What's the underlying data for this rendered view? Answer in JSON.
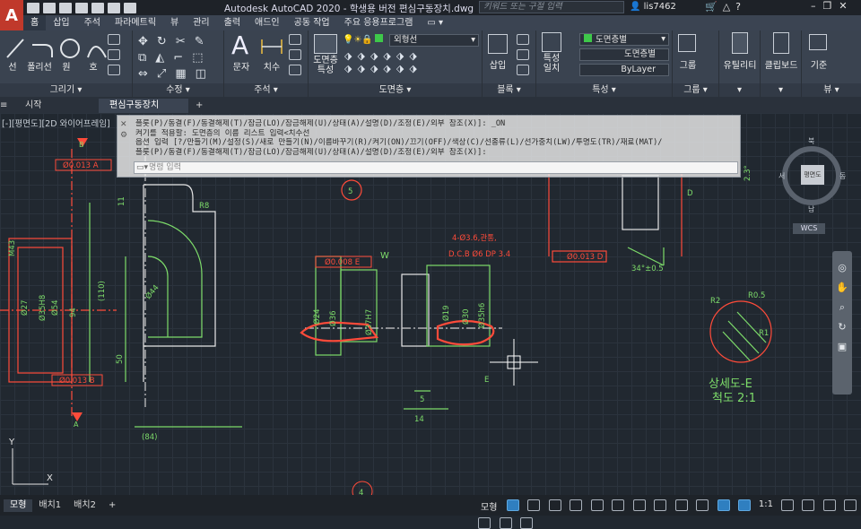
{
  "app": {
    "title": "Autodesk AutoCAD 2020 - 학생용 버전    편심구동장치.dwg",
    "search_placeholder": "키워드 또는 구절 입력",
    "user": "lis7462",
    "app_letter": "A"
  },
  "ribbon_tabs": [
    "홈",
    "삽입",
    "주석",
    "파라메트릭",
    "뷰",
    "관리",
    "출력",
    "애드인",
    "공동 작업",
    "주요 응용프로그램"
  ],
  "ribbon": {
    "draw": {
      "title": "그리기",
      "tools": [
        "선",
        "폴리선",
        "원",
        "호"
      ]
    },
    "modify": {
      "title": "수정"
    },
    "annotation": {
      "title": "주석",
      "tools": [
        "문자",
        "치수"
      ]
    },
    "layers": {
      "title": "도면층",
      "tool": "도면층 특성",
      "current_layer": "외형선"
    },
    "block": {
      "title": "블록",
      "tool": "삽입"
    },
    "properties": {
      "title": "특성",
      "tool": "특성 일치",
      "color": "도면층별",
      "linetype": "도면층별",
      "lineweight": "ByLayer"
    },
    "groups": {
      "title": "그룹",
      "tool": "그룹"
    },
    "utilities": {
      "tool": "유틸리티"
    },
    "clipboard": {
      "tool": "클립보드"
    },
    "view": {
      "title": "뷰",
      "tool": "기준"
    }
  },
  "file_tabs": [
    "시작",
    "편심구동장치*"
  ],
  "viewport_label": "[-][평면도][2D 와이어프레임]",
  "command": {
    "lines": [
      "플롯(P)/동결(F)/동결해제(T)/잠금(LO)/잠금해제(U)/상태(A)/설명(D)/조정(E)/외부 참조(X)]: _ON",
      "켜기를 적용할:  도면층의 이름 리스트 입력<치수선",
      "옵션 입력 [?/만들기(M)/설정(S)/새로 만들기(N)/이름바꾸기(R)/켜기(ON)/끄기(OFF)/색상(C)/선종류(L)/선가중치(LW)/투명도(TR)/재료(MAT)/",
      "플롯(P)/동결(F)/동결해제(T)/잠금(LO)/잠금해제(U)/상태(A)/설명(D)/조정(E)/외부 참조(X)]:"
    ],
    "input_placeholder": "명령 입력"
  },
  "viewcube": {
    "face": "평면도",
    "north": "북",
    "east": "동",
    "west": "서",
    "south": "남",
    "wcs": "WCS"
  },
  "drawing": {
    "dims_left": [
      "Ø0.013 A",
      "Ø0.013 B",
      "(84)",
      "(110)",
      "94",
      "50",
      "11",
      "R8",
      "Ø44",
      "Ø54",
      "Ø35H8",
      "Ø27",
      "M43"
    ],
    "labels": [
      "B",
      "A",
      "5",
      "W",
      "E",
      "D",
      "4"
    ],
    "center": [
      "4-Ø3.6,관통,",
      "D.C.B  Ø6  DP  3.4",
      "Ø0.008 E",
      "Ø24",
      "Ø36",
      "Ø37H7",
      "Ø19",
      "Ø30",
      "Ø35h6",
      "14",
      "5",
      "Ø0.013 D",
      "34°±0.5",
      "2.3°"
    ],
    "detail": [
      "R2",
      "R0.5",
      "R1",
      "상세도-E",
      "척도 2:1"
    ]
  },
  "layout_tabs": [
    "모형",
    "배치1",
    "배치2"
  ],
  "status": {
    "model": "모형",
    "scale": "1:1"
  }
}
